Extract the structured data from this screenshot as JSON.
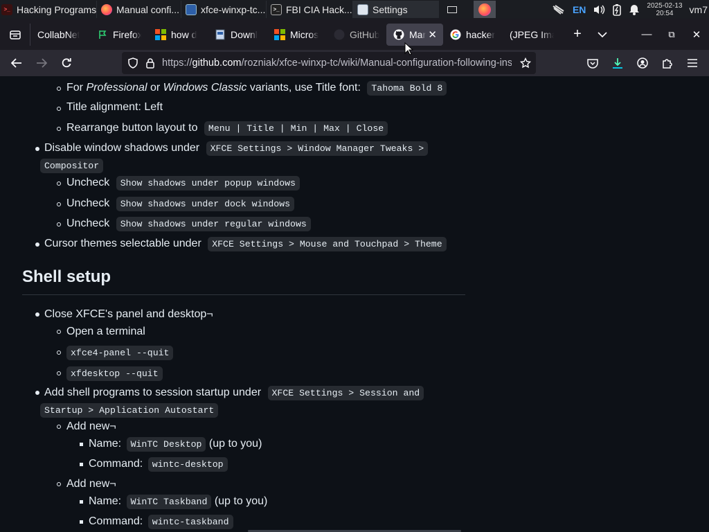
{
  "os_taskbar": {
    "tasks": [
      {
        "label": "Hacking Programs ≡",
        "icon": "terminal-icon"
      },
      {
        "label": "Manual confi...",
        "icon": "firefox-icon"
      },
      {
        "label": "xfce-winxp-tc...",
        "icon": "window-icon"
      },
      {
        "label": "FBI CIA Hack...",
        "icon": "terminal-icon"
      },
      {
        "label": "Settings",
        "icon": "settings-icon"
      }
    ],
    "lang": "EN",
    "date": "2025-02-13",
    "time": "20:54",
    "user": "vm7"
  },
  "tabs": [
    {
      "label": "CollabNet",
      "icon": "none"
    },
    {
      "label": "Firefox",
      "icon": "flag-icon"
    },
    {
      "label": "how d",
      "icon": "microsoft-icon"
    },
    {
      "label": "Downl",
      "icon": "page-icon"
    },
    {
      "label": "Micros",
      "icon": "microsoft-icon"
    },
    {
      "label": "GitHub",
      "icon": "github-icon"
    },
    {
      "label": "Mar",
      "icon": "github-icon"
    },
    {
      "label": "hacker",
      "icon": "google-icon"
    },
    {
      "label": "(JPEG Ima",
      "icon": "none"
    }
  ],
  "url": {
    "prefix": "https://",
    "domain": "github.com",
    "path": "/rozniak/xfce-winxp-tc/wiki/Manual-configuration-following-install"
  },
  "content": {
    "l1": {
      "pre": "For ",
      "em1": "Professional",
      "mid": " or ",
      "em2": "Windows Classic",
      "post": " variants, use Title font:",
      "code": "Tahoma Bold 8"
    },
    "l2": "Title alignment: Left",
    "l3": {
      "text": "Rearrange button layout to",
      "code": "Menu | Title | Min | Max | Close"
    },
    "l4": {
      "text": "Disable window shadows under",
      "code_a": "XFCE Settings > Window Manager Tweaks >",
      "code_b": "Compositor"
    },
    "l5": {
      "text": "Uncheck",
      "code": "Show shadows under popup windows"
    },
    "l6": {
      "text": "Uncheck",
      "code": "Show shadows under dock windows"
    },
    "l7": {
      "text": "Uncheck",
      "code": "Show shadows under regular windows"
    },
    "l8": {
      "text": "Cursor themes selectable under",
      "code": "XFCE Settings > Mouse and Touchpad > Theme"
    },
    "heading": "Shell setup",
    "l9": "Close XFCE's panel and desktop¬",
    "l10": "Open a terminal",
    "l11": "xfce4-panel --quit",
    "l12": "xfdesktop --quit",
    "l13": {
      "text": "Add shell programs to session startup under",
      "code_a": "XFCE Settings > Session and",
      "code_b": "Startup > Application Autostart"
    },
    "l14": "Add new¬",
    "l15": {
      "text": "Name:",
      "code": "WinTC Desktop",
      "post": "(up to you)"
    },
    "l16": {
      "text": "Command:",
      "code": "wintc-desktop"
    },
    "l17": "Add new¬",
    "l18": {
      "text": "Name:",
      "code": "WinTC Taskband",
      "post": "(up to you)"
    },
    "l19": {
      "text": "Command:",
      "code": "wintc-taskband"
    }
  }
}
